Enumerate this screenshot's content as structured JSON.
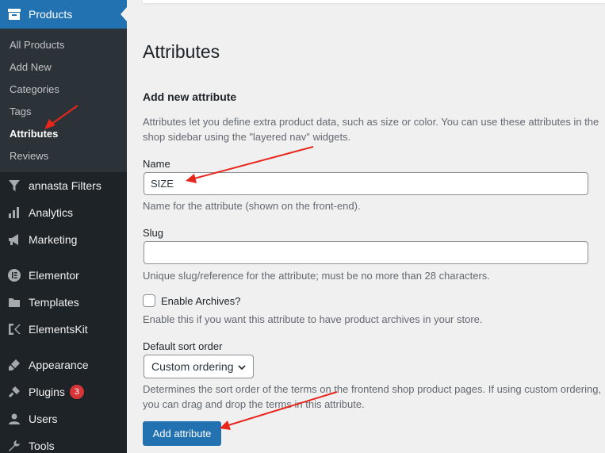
{
  "sidebar": {
    "active_menu": "Products",
    "submenu": [
      {
        "label": "All Products",
        "current": false
      },
      {
        "label": "Add New",
        "current": false
      },
      {
        "label": "Categories",
        "current": false
      },
      {
        "label": "Tags",
        "current": false
      },
      {
        "label": "Attributes",
        "current": true
      },
      {
        "label": "Reviews",
        "current": false
      }
    ],
    "items": [
      {
        "label": "annasta Filters",
        "icon": "funnel-icon"
      },
      {
        "label": "Analytics",
        "icon": "bar-chart-icon"
      },
      {
        "label": "Marketing",
        "icon": "megaphone-icon"
      },
      {
        "label": "Elementor",
        "icon": "elementor-icon"
      },
      {
        "label": "Templates",
        "icon": "folder-icon"
      },
      {
        "label": "ElementsKit",
        "icon": "elementskit-icon"
      },
      {
        "label": "Appearance",
        "icon": "paintbrush-icon"
      },
      {
        "label": "Plugins",
        "icon": "plugin-icon",
        "badge": "3"
      },
      {
        "label": "Users",
        "icon": "user-icon"
      },
      {
        "label": "Tools",
        "icon": "wrench-icon"
      }
    ]
  },
  "main": {
    "title": "Attributes",
    "section_title": "Add new attribute",
    "intro": "Attributes let you define extra product data, such as size or color. You can use these attributes in the shop sidebar using the \"layered nav\" widgets.",
    "name_label": "Name",
    "name_value": "SIZE",
    "name_help": "Name for the attribute (shown on the front-end).",
    "slug_label": "Slug",
    "slug_value": "",
    "slug_help": "Unique slug/reference for the attribute; must be no more than 28 characters.",
    "archives_label": "Enable Archives?",
    "archives_checked": false,
    "archives_help": "Enable this if you want this attribute to have product archives in your store.",
    "sort_label": "Default sort order",
    "sort_value": "Custom ordering",
    "sort_help": "Determines the sort order of the terms on the frontend shop product pages. If using custom ordering, you can drag and drop the terms in this attribute.",
    "submit_label": "Add attribute"
  },
  "colors": {
    "sidebar_bg": "#1d2327",
    "submenu_bg": "#2c3338",
    "accent": "#2271b1",
    "badge": "#d63638",
    "annotation_arrow": "#e8261c"
  }
}
